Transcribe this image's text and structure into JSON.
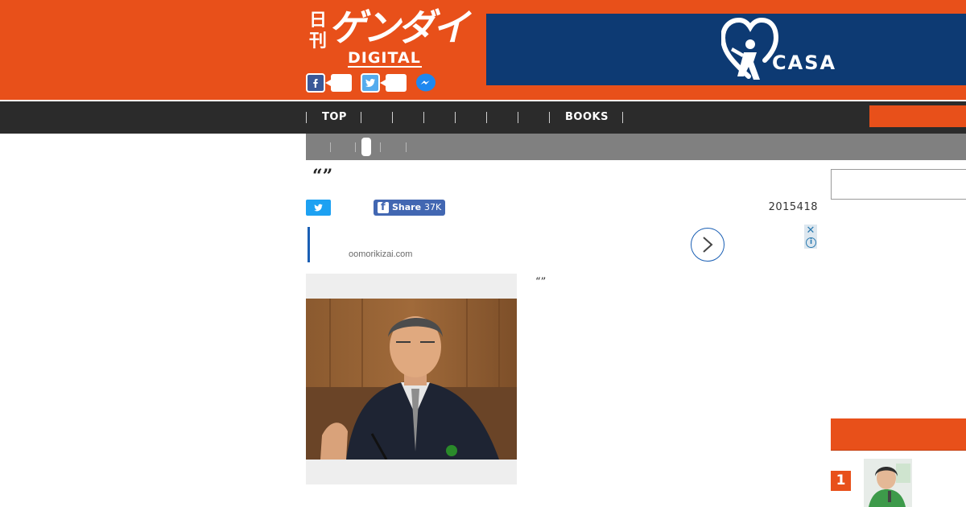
{
  "header": {
    "logo_kanji": "日刊",
    "logo_main": "ゲンダイ",
    "logo_sub": "DIGITAL",
    "brand_color": "#e8501a"
  },
  "ad_banner": {
    "brand": "CASA",
    "background": "#0d3a73"
  },
  "nav": {
    "items": [
      "TOP",
      "",
      "",
      "",
      "",
      "",
      "",
      "BOOKS"
    ]
  },
  "article": {
    "headline": "“”",
    "share": {
      "label": "Share",
      "count": "37K"
    },
    "date": "2015418",
    "body_text": "“”"
  },
  "inline_ad": {
    "domain": "oomorikizai.com"
  },
  "ranking": {
    "items": [
      {
        "rank": "1"
      }
    ]
  },
  "icons": [
    "facebook-icon",
    "twitter-icon",
    "messenger-icon",
    "casa-heart-logo",
    "chevron-right-icon",
    "close-icon",
    "info-icon"
  ]
}
